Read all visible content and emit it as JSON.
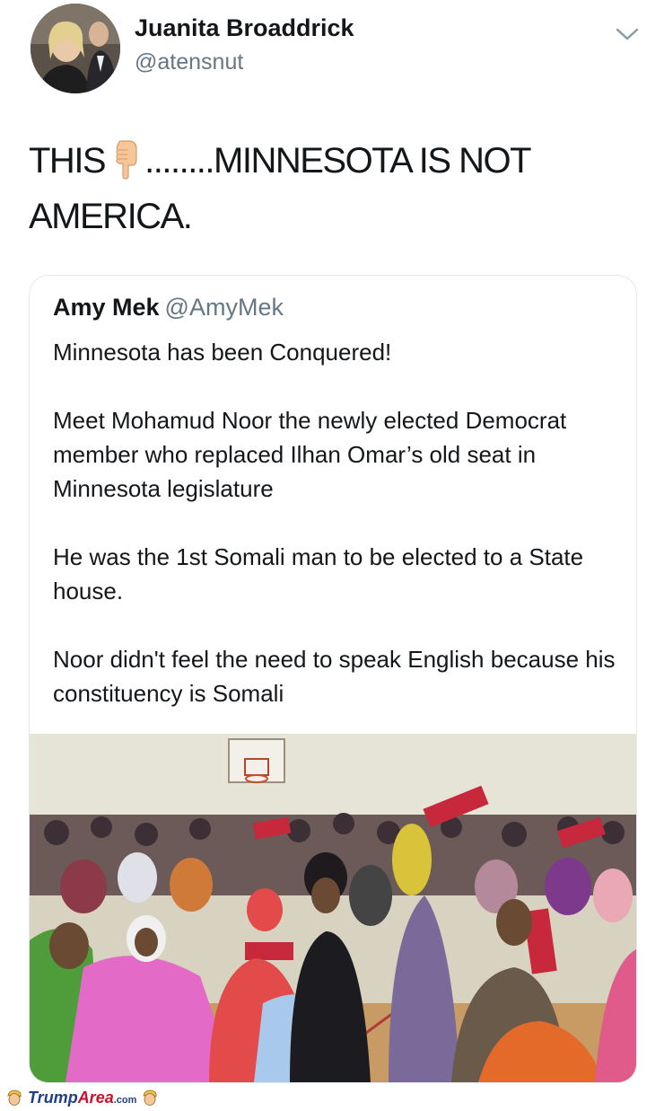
{
  "tweet": {
    "author_name": "Juanita Broaddrick",
    "author_handle": "@atensnut",
    "text_part1": "THIS",
    "emoji": "pointing-down-hand",
    "text_part2": "........MINNESOTA IS NOT AMERICA."
  },
  "quoted_tweet": {
    "author_name": "Amy Mek",
    "author_handle": "@AmyMek",
    "paragraphs": [
      "Minnesota has been Conquered!",
      "Meet Mohamud Noor the newly elected Democrat member who replaced Ilhan Omar’s old seat in Minnesota legislature",
      "He was the 1st Somali man to be elected to a State house.",
      "Noor didn't feel the need to speak English because his constituency is Somali"
    ],
    "media": "photo-crowd-in-gym"
  },
  "watermark": {
    "part1": "Trump",
    "part2": "Area",
    "part3": ".com"
  },
  "colors": {
    "text": "#14171a",
    "secondary": "#657786",
    "border": "#e1e8ed",
    "watermark_blue": "#1f3f86",
    "watermark_red": "#c8102e"
  }
}
